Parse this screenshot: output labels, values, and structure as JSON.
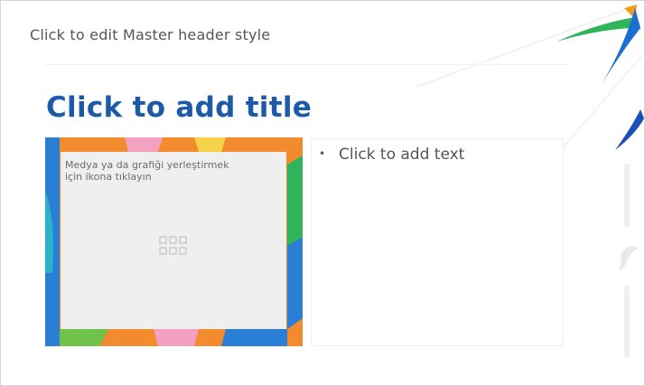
{
  "slide": {
    "master_header": "Click to edit Master header style",
    "title": "Click to add title",
    "media_placeholder": {
      "prompt_line1": "Medya ya da grafiği yerleştirmek",
      "prompt_line2": "için ikona tıklayın"
    },
    "content_placeholder": {
      "bullet": "Click to add text"
    }
  },
  "colors": {
    "title": "#1d5aa8",
    "frame_orange": "#f28a2e",
    "accent_blue": "#1a6fd1",
    "accent_green": "#2fb45a",
    "accent_orange": "#f39a1e"
  },
  "icons": [
    "insert-table-icon",
    "insert-chart-icon",
    "insert-smartart-icon",
    "insert-picture-icon",
    "insert-clipart-icon",
    "insert-media-icon"
  ]
}
